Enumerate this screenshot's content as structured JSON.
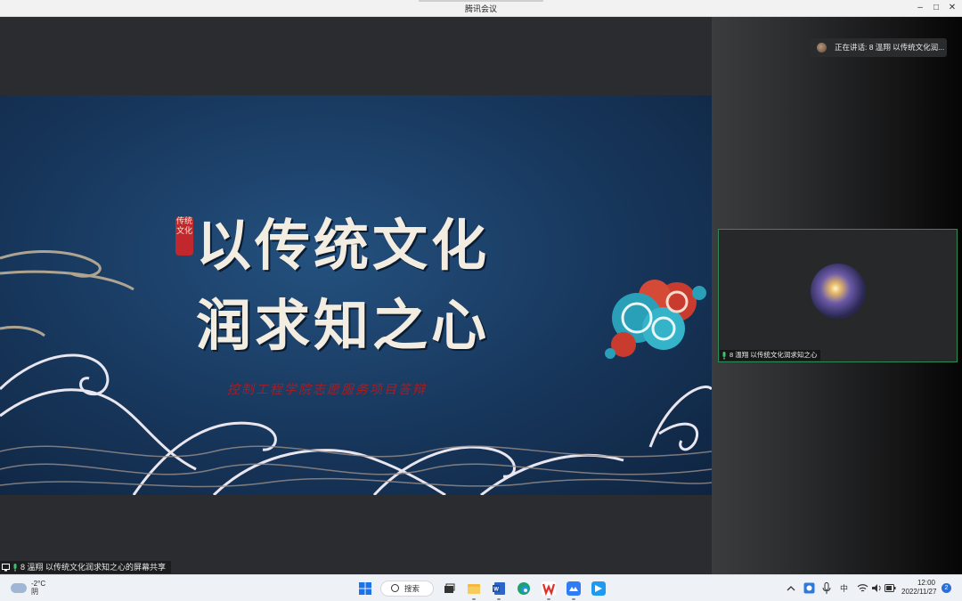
{
  "window": {
    "title": "腾讯会议"
  },
  "slide": {
    "title_line1": "以传统文化",
    "title_line2": "润求知之心",
    "seal_text": "传统文化",
    "subtitle": "控制工程学院志愿服务项目答辩"
  },
  "share_label": "8 溫翔 以传统文化润求知之心的屏幕共享",
  "right_panel": {
    "speaking": "正在讲话: 8 溫翔 以传统文化润...",
    "participant_label": "8 溫翔 以传统文化润求知之心"
  },
  "taskbar": {
    "weather_temp": "-2°C",
    "weather_cond": "阴",
    "search_label": "搜索",
    "ime": "中",
    "time": "12:00",
    "date": "2022/11/27",
    "notification_count": "2"
  },
  "colors": {
    "accent_green": "#2e8b57",
    "seal_red": "#c0282d",
    "slide_blue": "#17365b"
  }
}
